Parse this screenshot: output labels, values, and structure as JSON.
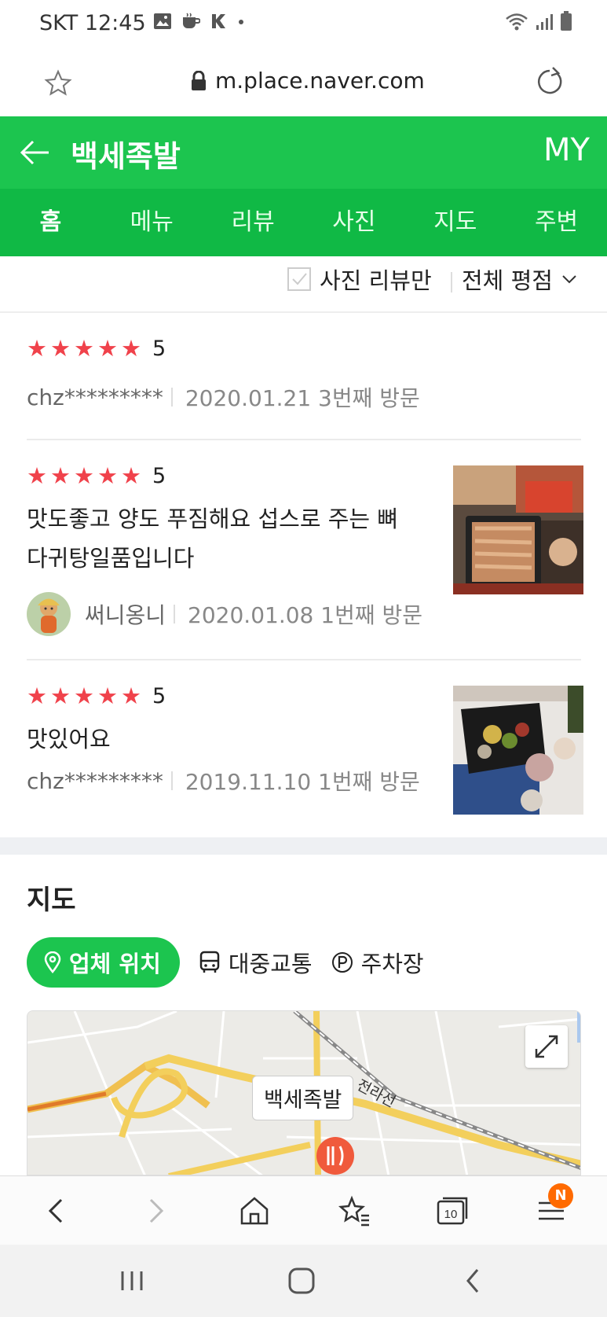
{
  "status_bar": {
    "carrier_time": "SKT 12:45",
    "icons": [
      "gallery-icon",
      "coffee-icon",
      "kakao-icon",
      "dot-icon"
    ],
    "right_icons": [
      "wifi-icon",
      "signal-icon",
      "battery-icon"
    ]
  },
  "browser": {
    "url": "m.place.naver.com",
    "lock_icon": "lock-icon"
  },
  "header": {
    "title": "백세족발",
    "my_label": "MY",
    "color": "#1cc54f"
  },
  "tabs": [
    {
      "label": "홈",
      "active": true
    },
    {
      "label": "메뉴",
      "active": false
    },
    {
      "label": "리뷰",
      "active": false
    },
    {
      "label": "사진",
      "active": false
    },
    {
      "label": "지도",
      "active": false
    },
    {
      "label": "주변",
      "active": false
    }
  ],
  "filters": {
    "photo_review_only": "사진 리뷰만",
    "rating_filter": "전체 평점"
  },
  "reviews": [
    {
      "stars": 5,
      "score": "5",
      "text": "",
      "author": "chz*********",
      "date_visit": "2020.01.21 3번째 방문",
      "has_photo": false,
      "has_avatar": false
    },
    {
      "stars": 5,
      "score": "5",
      "text_line1": "맛도좋고 양도 푸짐해요 섭스로 주는 뼈",
      "text_line2": "다귀탕일품입니다",
      "author": "써니옹니",
      "date_visit": "2020.01.08 1번째 방문",
      "has_photo": true,
      "has_avatar": true
    },
    {
      "stars": 5,
      "score": "5",
      "text": "맛있어요",
      "author": "chz*********",
      "date_visit": "2019.11.10 1번째 방문",
      "has_photo": true,
      "has_avatar": false
    }
  ],
  "star_color": "#f0424b",
  "map_section": {
    "title": "지도",
    "tabs": [
      {
        "label": "업체 위치",
        "icon": "location-pin-icon",
        "active": true
      },
      {
        "label": "대중교통",
        "icon": "bus-icon",
        "active": false
      },
      {
        "label": "주차장",
        "icon": "parking-icon",
        "active": false
      }
    ],
    "marker_label": "백세족발",
    "rail_label": "전라선"
  },
  "toolbar": {
    "tabs_count": "10",
    "menu_badge": "N",
    "buttons": [
      "back-icon",
      "forward-icon",
      "home-icon",
      "bookmarks-icon",
      "tabs-icon",
      "menu-icon"
    ]
  }
}
